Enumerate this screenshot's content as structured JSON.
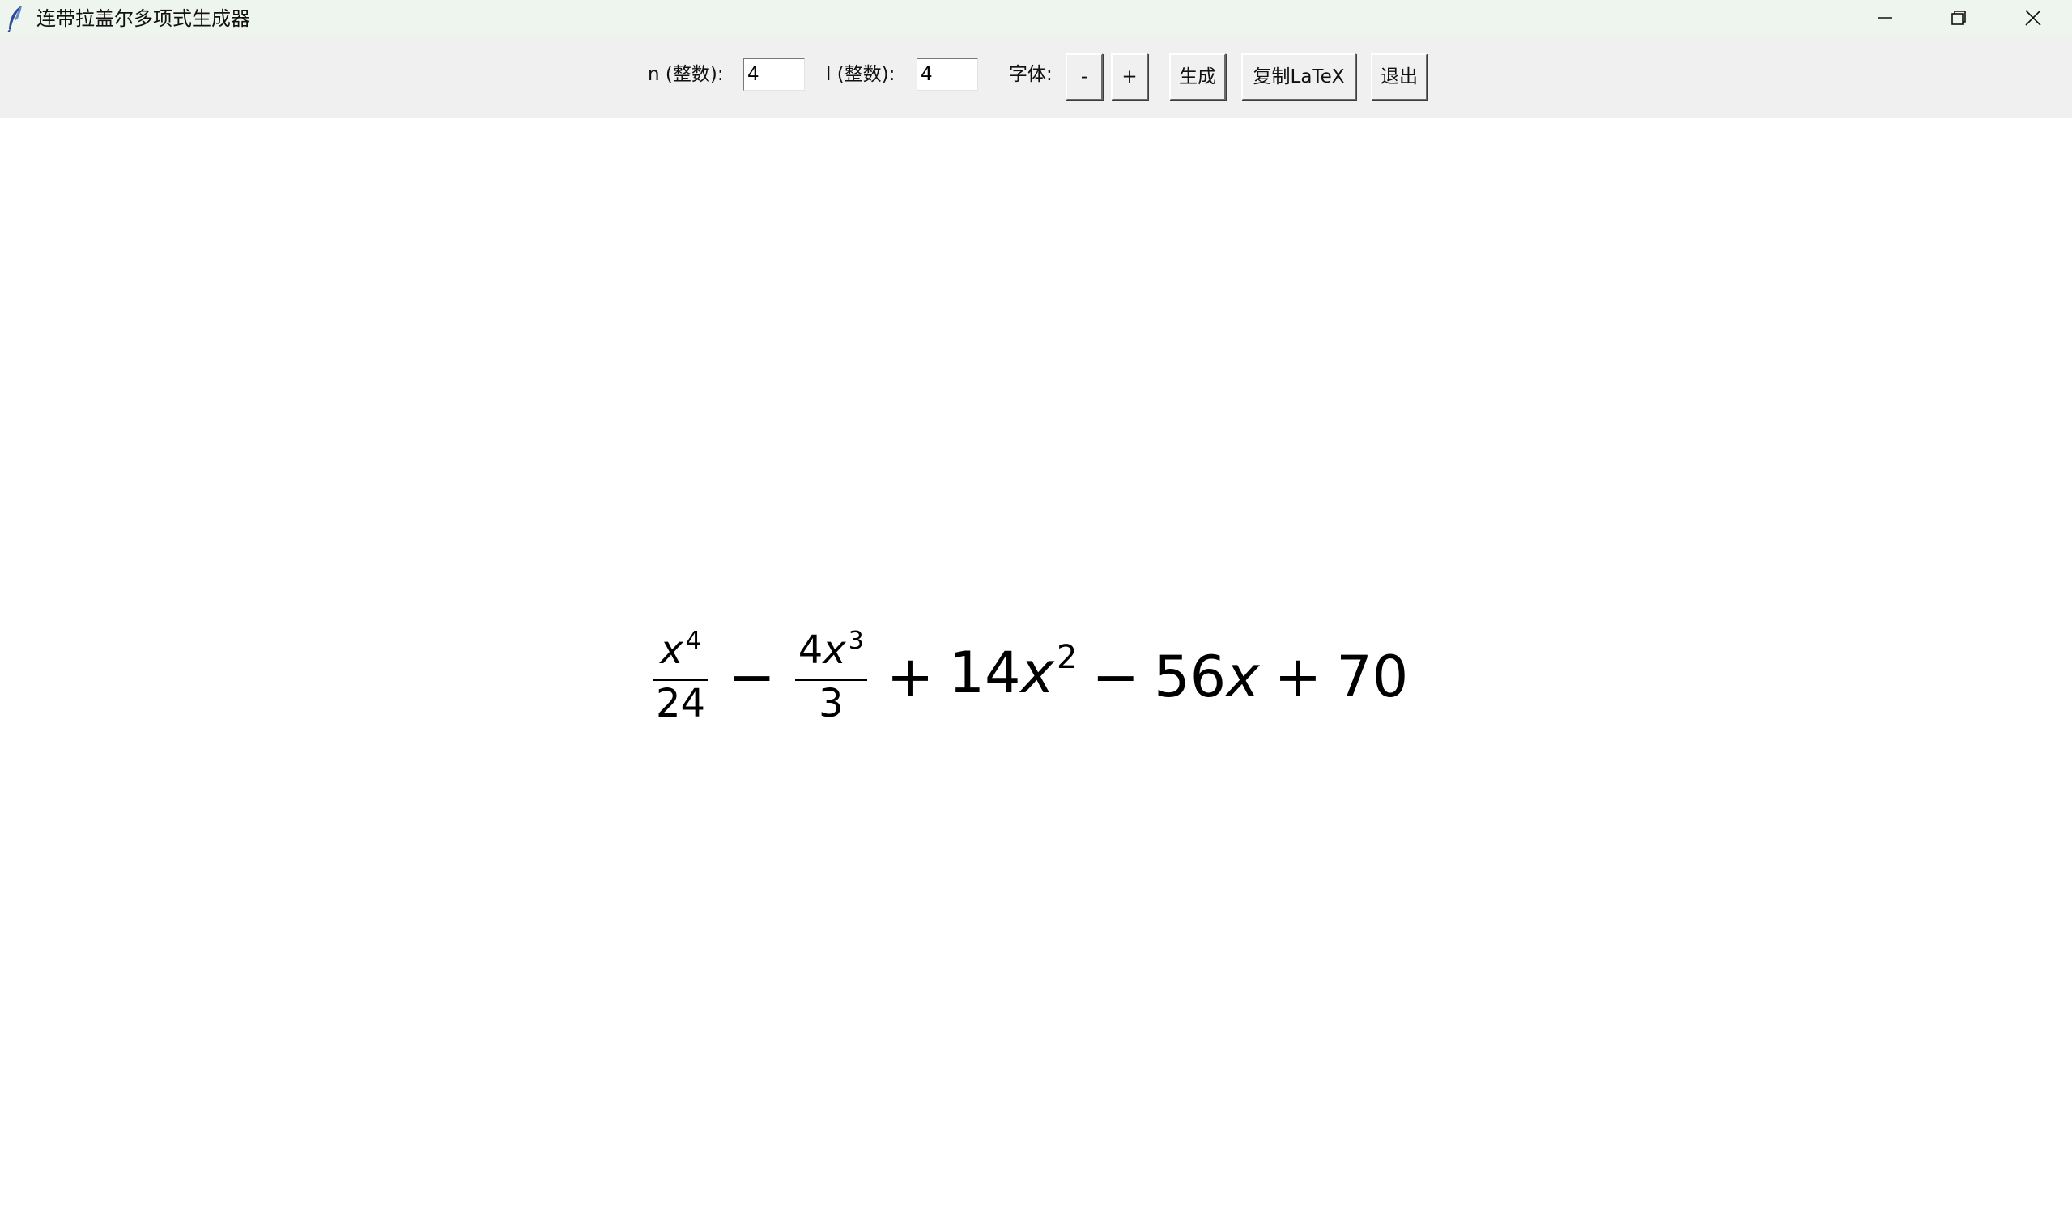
{
  "window": {
    "title": "连带拉盖尔多项式生成器",
    "controls": [
      "minimize-icon",
      "restore-icon",
      "close-icon"
    ]
  },
  "toolbar": {
    "n_label": "n (整数):",
    "n_value": "4",
    "l_label": "l (整数):",
    "l_value": "4",
    "font_label": "字体:",
    "font_decrease": "-",
    "font_increase": "+",
    "generate": "生成",
    "copy_latex": "复制LaTeX",
    "exit": "退出"
  },
  "formula": {
    "t1_num_var": "x",
    "t1_num_exp": "4",
    "t1_den": "24",
    "op1": "−",
    "t2_num_coef": "4",
    "t2_num_var": "x",
    "t2_num_exp": "3",
    "t2_den": "3",
    "op2": "+",
    "t3_coef": "14",
    "t3_var": "x",
    "t3_exp": "2",
    "op3": "−",
    "t4_coef": "56",
    "t4_var": "x",
    "op4": "+",
    "t5_const": "70"
  }
}
